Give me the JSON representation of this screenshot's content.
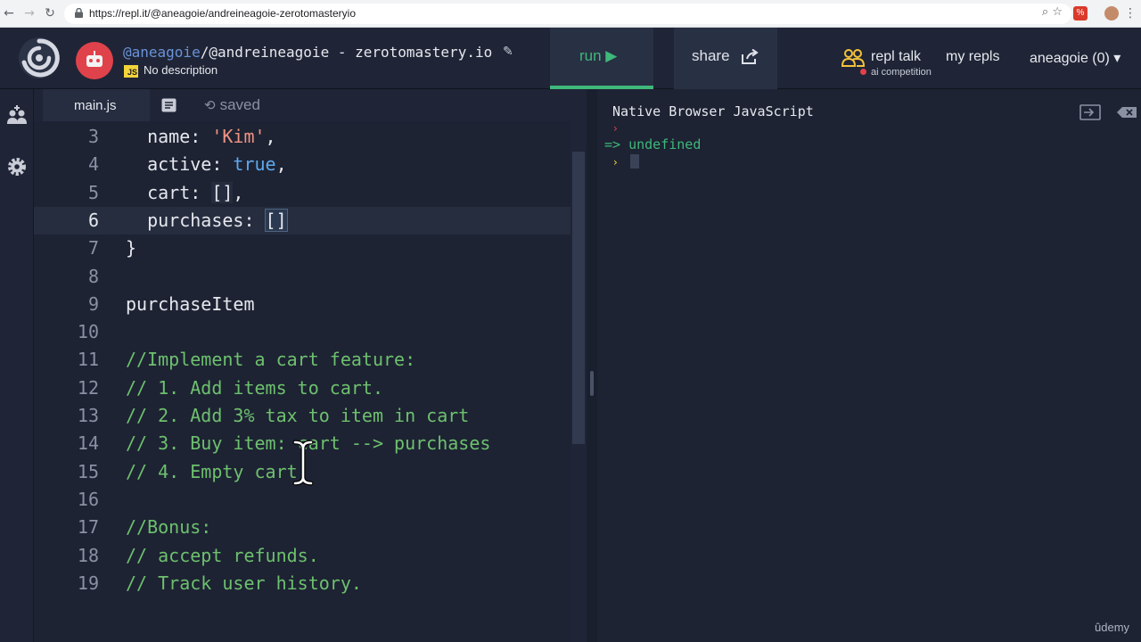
{
  "browser": {
    "url": "https://repl.it/@aneagoie/andreineagoie-zerotomasteryio",
    "ext_label": "%"
  },
  "header": {
    "owner": "@aneagoie",
    "repl_name": "/@andreineagoie - zerotomastery.io",
    "language_badge": "JS",
    "description": "No description",
    "run_label": "run ▶",
    "share_label": "share",
    "repl_talk_label": "repl talk",
    "competition_label": "ai competition",
    "my_repls_label": "my repls",
    "user_label": "aneagoie (0) ▾"
  },
  "editor": {
    "file_tab": "main.js",
    "saved_label": "saved",
    "lines": [
      {
        "num": "3",
        "segments": [
          {
            "t": "  name: "
          },
          {
            "t": "'Kim'",
            "c": "str"
          },
          {
            "t": ","
          }
        ]
      },
      {
        "num": "4",
        "segments": [
          {
            "t": "  active: "
          },
          {
            "t": "true",
            "c": "kw"
          },
          {
            "t": ","
          }
        ]
      },
      {
        "num": "5",
        "segments": [
          {
            "t": "  cart: "
          },
          {
            "t": "[]",
            "c": "bracket-dim"
          },
          {
            "t": ","
          }
        ]
      },
      {
        "num": "6",
        "active": true,
        "segments": [
          {
            "t": "  purchases: "
          },
          {
            "t": "[]",
            "c": "bracket-hl"
          }
        ]
      },
      {
        "num": "7",
        "segments": [
          {
            "t": "}"
          }
        ]
      },
      {
        "num": "8",
        "segments": []
      },
      {
        "num": "9",
        "segments": [
          {
            "t": "purchaseItem"
          }
        ]
      },
      {
        "num": "10",
        "segments": []
      },
      {
        "num": "11",
        "segments": [
          {
            "t": "//Implement a cart feature:",
            "c": "cmt"
          }
        ]
      },
      {
        "num": "12",
        "segments": [
          {
            "t": "// 1. Add items to cart.",
            "c": "cmt"
          }
        ]
      },
      {
        "num": "13",
        "segments": [
          {
            "t": "// 2. Add 3% tax to item in cart",
            "c": "cmt"
          }
        ]
      },
      {
        "num": "14",
        "segments": [
          {
            "t": "// 3. Buy item: cart --> purchases",
            "c": "cmt"
          }
        ]
      },
      {
        "num": "15",
        "segments": [
          {
            "t": "// 4. Empty cart",
            "c": "cmt"
          }
        ]
      },
      {
        "num": "16",
        "segments": []
      },
      {
        "num": "17",
        "segments": [
          {
            "t": "//Bonus:",
            "c": "cmt"
          }
        ]
      },
      {
        "num": "18",
        "segments": [
          {
            "t": "// accept refunds.",
            "c": "cmt"
          }
        ]
      },
      {
        "num": "19",
        "segments": [
          {
            "t": "// Track user history.",
            "c": "cmt"
          }
        ]
      }
    ]
  },
  "console": {
    "title": "Native Browser JavaScript",
    "result": "=> undefined"
  },
  "watermark": "ûdemy",
  "colors": {
    "accent_green": "#3fb87a",
    "background": "#1d2333",
    "comment": "#6ec06e",
    "string": "#f09383",
    "keyword": "#5ea8ee"
  }
}
